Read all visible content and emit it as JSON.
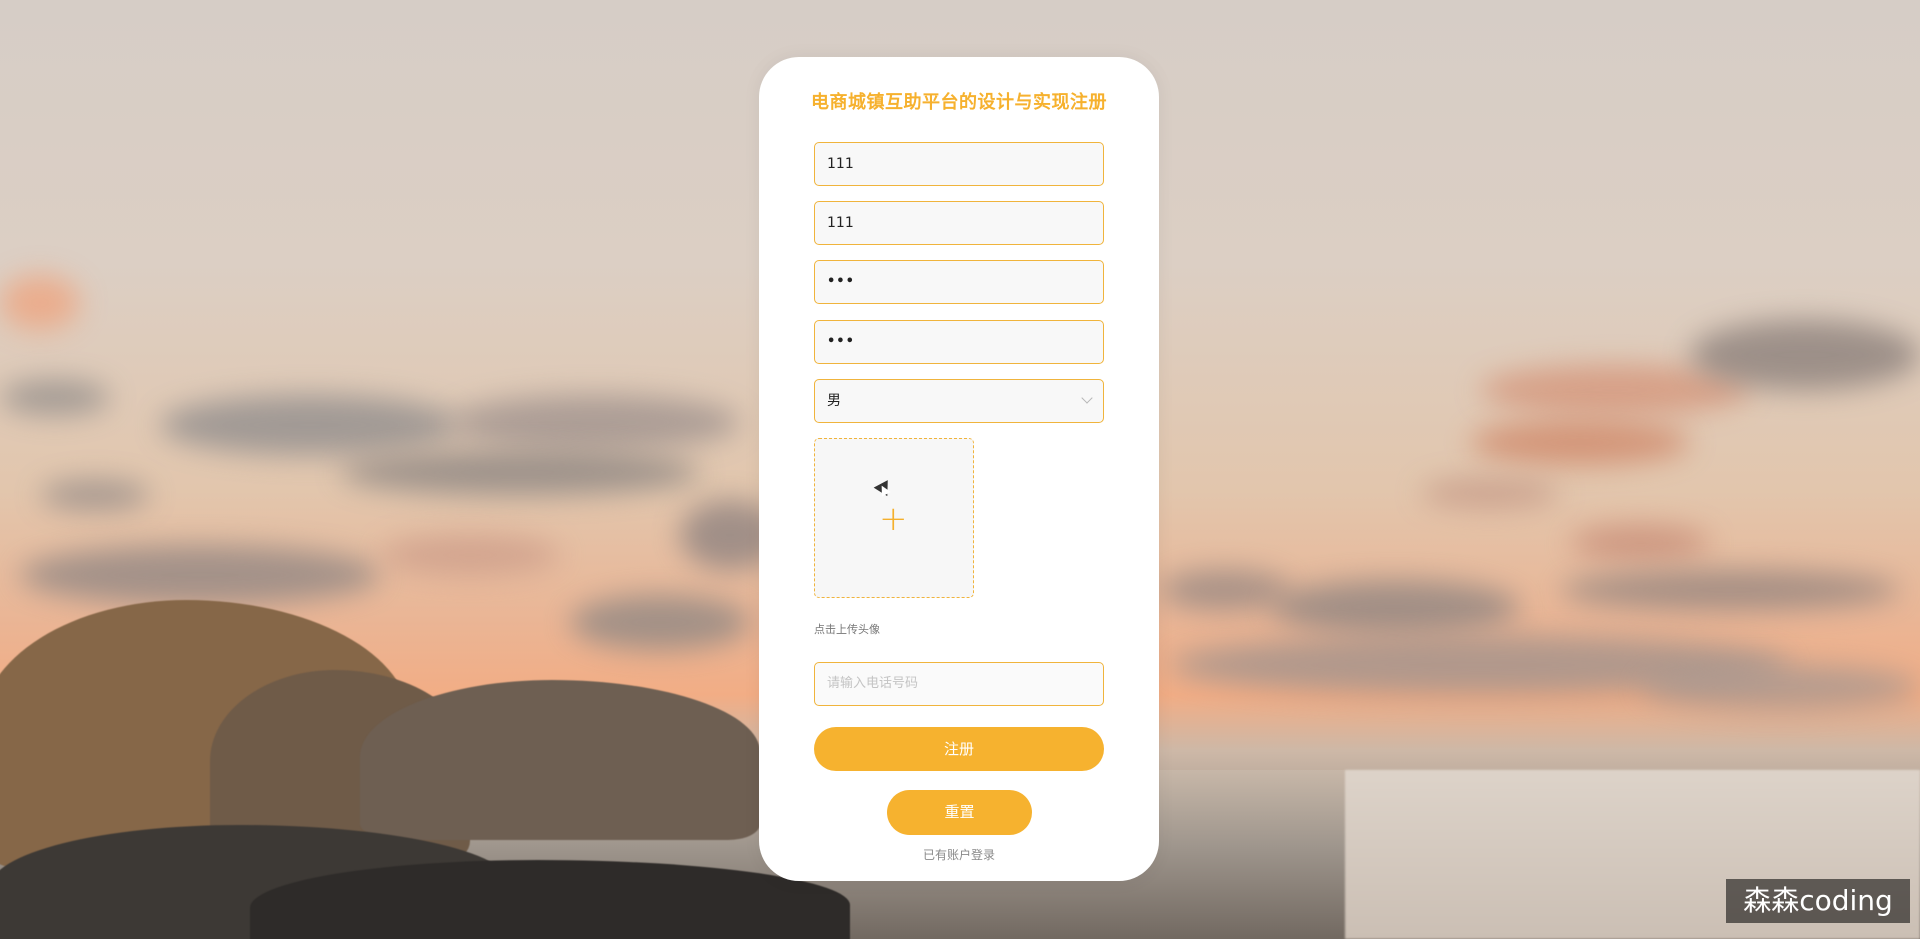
{
  "form": {
    "title": "电商城镇互助平台的设计与实现注册",
    "account_value": "111",
    "name_value": "111",
    "password_value": "•••",
    "confirm_password_value": "•••",
    "gender_selected": "男",
    "upload_hint": "点击上传头像",
    "phone_placeholder": "请输入电话号码",
    "register_label": "注册",
    "reset_label": "重置",
    "login_link_label": "已有账户登录"
  },
  "watermark": {
    "text": "森森coding"
  },
  "colors": {
    "accent": "#f6b22f",
    "accent_text": "#f6b12e"
  }
}
